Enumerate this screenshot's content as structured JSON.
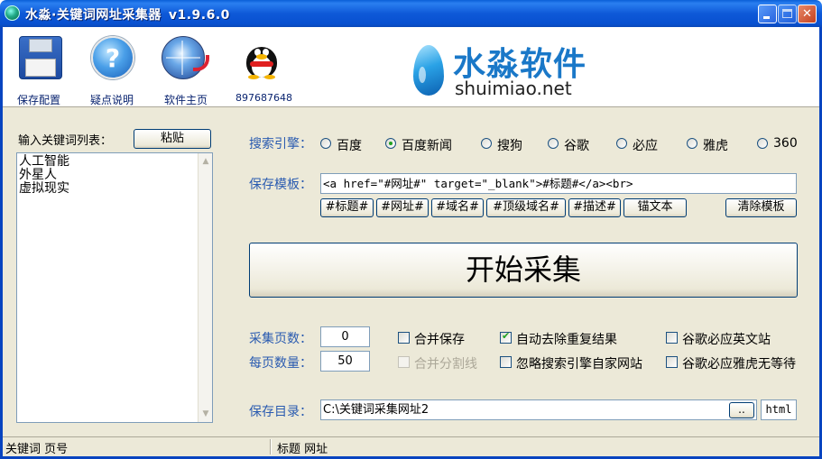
{
  "window": {
    "title": "水淼·关键词网址采集器",
    "version": "v1.9.6.0"
  },
  "toolbar": {
    "items": [
      {
        "label": "保存配置",
        "icon": "floppy-disk-icon"
      },
      {
        "label": "疑点说明",
        "icon": "help-icon"
      },
      {
        "label": "软件主页",
        "icon": "globe-icon"
      },
      {
        "label": "897687648",
        "icon": "qq-penguin-icon"
      }
    ]
  },
  "brand": {
    "name_cn": "水淼软件",
    "domain": "shuimiao.net"
  },
  "keywords": {
    "label": "输入关键词列表：",
    "paste_label": "粘贴",
    "lines": [
      "人工智能",
      "外星人",
      "虚拟现实"
    ]
  },
  "search_engine": {
    "label": "搜索引擎：",
    "options": [
      "百度",
      "百度新闻",
      "搜狗",
      "谷歌",
      "必应",
      "雅虎",
      "360"
    ],
    "selected": "百度新闻"
  },
  "template": {
    "label": "保存模板：",
    "value": "<a href=\"#网址#\" target=\"_blank\">#标题#</a><br>",
    "tags": [
      "#标题#",
      "#网址#",
      "#域名#",
      "#顶级域名#",
      "#描述#"
    ],
    "anchor_text_label": "锚文本",
    "clear_label": "清除模板"
  },
  "start_label": "开始采集",
  "pages": {
    "label": "采集页数：",
    "value": "0"
  },
  "per_page": {
    "label": "每页数量：",
    "value": "50"
  },
  "options": {
    "merge_save": {
      "label": "合并保存",
      "checked": false
    },
    "merge_divider": {
      "label": "合并分割线",
      "checked": false,
      "disabled": true
    },
    "dedupe": {
      "label": "自动去除重复结果",
      "checked": true
    },
    "ignore_own": {
      "label": "忽略搜索引擎自家网站",
      "checked": false
    },
    "english_sites": {
      "label": "谷歌必应英文站",
      "checked": false
    },
    "no_wait": {
      "label": "谷歌必应雅虎无等待",
      "checked": false
    }
  },
  "save_dir": {
    "label": "保存目录：",
    "value": "C:\\关键词采集网址2",
    "browse_label": "..",
    "extension": "html"
  },
  "status": {
    "left": "关键词 页号",
    "right": "标题 网址"
  },
  "colors": {
    "title_bar": "#0a55d0",
    "label_blue": "#2a5bb0",
    "panel_bg": "#ece9d8",
    "brand_blue": "#1a78c8"
  }
}
